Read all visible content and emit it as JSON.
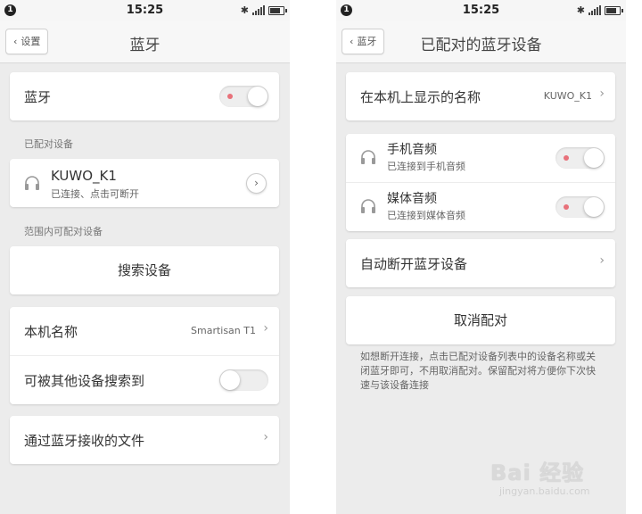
{
  "status_bar": {
    "notification": "1",
    "time": "15:25",
    "bluetooth_icon": "bluetooth-icon",
    "signal_icon": "signal-icon",
    "battery_icon": "battery-icon"
  },
  "left": {
    "back_label": "设置",
    "title": "蓝牙",
    "bluetooth_label": "蓝牙",
    "bluetooth_on": true,
    "paired_section": "已配对设备",
    "paired_device": {
      "name": "KUWO_K1",
      "status": "已连接、点击可断开",
      "icon": "headphone-icon"
    },
    "available_section": "范围内可配对设备",
    "search_button": "搜索设备",
    "device_name_label": "本机名称",
    "device_name_value": "Smartisan T1",
    "discoverable_label": "可被其他设备搜索到",
    "discoverable_on": false,
    "received_files_label": "通过蓝牙接收的文件"
  },
  "right": {
    "back_label": "蓝牙",
    "title": "已配对的蓝牙设备",
    "display_name_label": "在本机上显示的名称",
    "display_name_value": "KUWO_K1",
    "profiles": [
      {
        "name": "手机音频",
        "status": "已连接到手机音频",
        "on": true,
        "icon": "headphone-icon"
      },
      {
        "name": "媒体音频",
        "status": "已连接到媒体音频",
        "on": true,
        "icon": "headphone-icon"
      }
    ],
    "auto_disconnect_label": "自动断开蓝牙设备",
    "unpair_button": "取消配对",
    "hint_text": "如想断开连接，点击已配对设备列表中的设备名称或关闭蓝牙即可，不用取消配对。保留配对将方便你下次快速与该设备连接"
  },
  "watermark": {
    "text": "Bai 经验",
    "url": "jingyan.baidu.com"
  },
  "colors": {
    "toggle_dot": "#e8717a",
    "background": "#ececec",
    "card": "#ffffff"
  }
}
